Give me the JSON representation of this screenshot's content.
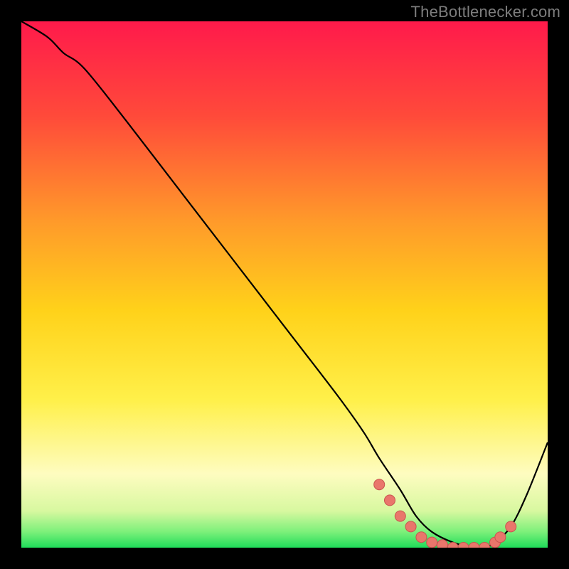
{
  "attribution": "TheBottlenecker.com",
  "colors": {
    "bg": "#000000",
    "gradient_top": "#ff1a4b",
    "gradient_mid_upper": "#ff7a2a",
    "gradient_mid": "#ffd21a",
    "gradient_lower": "#fff06a",
    "gradient_pale": "#fdfcd8",
    "gradient_green": "#1fdc5a",
    "curve": "#000000",
    "marker_fill": "#e9766b",
    "marker_stroke": "#c9544f"
  },
  "chart_data": {
    "type": "line",
    "title": "",
    "xlabel": "",
    "ylabel": "",
    "xlim": [
      0,
      100
    ],
    "ylim": [
      0,
      100
    ],
    "series": [
      {
        "name": "bottleneck-curve",
        "x": [
          0,
          5,
          8,
          12,
          20,
          30,
          40,
          50,
          60,
          65,
          68,
          72,
          75,
          78,
          82,
          86,
          88,
          90,
          93,
          96,
          100
        ],
        "y": [
          100,
          97,
          94,
          91,
          81,
          68,
          55,
          42,
          29,
          22,
          17,
          11,
          6,
          3,
          1,
          0,
          0,
          1,
          4,
          10,
          20
        ]
      }
    ],
    "markers": {
      "name": "highlight-dots",
      "x": [
        68,
        70,
        72,
        74,
        76,
        78,
        80,
        82,
        84,
        86,
        88,
        90,
        91,
        93
      ],
      "y": [
        12,
        9,
        6,
        4,
        2,
        1,
        0.5,
        0,
        0,
        0,
        0,
        1,
        2,
        4
      ]
    }
  }
}
